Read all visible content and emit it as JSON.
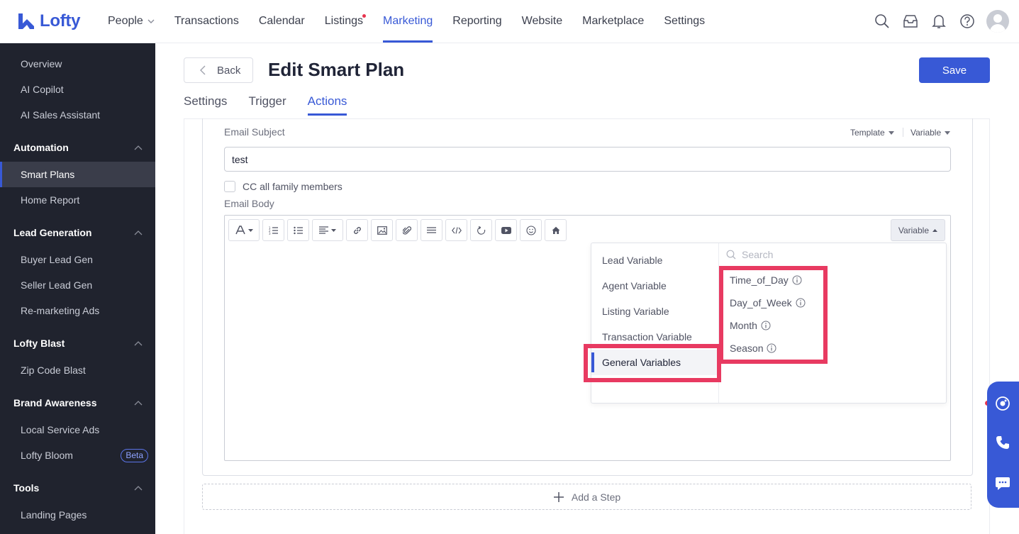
{
  "brand": {
    "name": "Lofty",
    "color": "#3859d6"
  },
  "nav": {
    "items": [
      "People",
      "Transactions",
      "Calendar",
      "Listings",
      "Marketing",
      "Reporting",
      "Website",
      "Marketplace",
      "Settings"
    ],
    "active": "Marketing"
  },
  "sidebar": {
    "top_items": [
      "Overview",
      "AI Copilot",
      "AI Sales Assistant"
    ],
    "groups": [
      {
        "title": "Automation",
        "items": [
          "Smart Plans",
          "Home Report"
        ]
      },
      {
        "title": "Lead Generation",
        "items": [
          "Buyer Lead Gen",
          "Seller Lead Gen",
          "Re-marketing Ads"
        ]
      },
      {
        "title": "Lofty Blast",
        "items": [
          "Zip Code Blast"
        ]
      },
      {
        "title": "Brand Awareness",
        "items": [
          "Local Service Ads",
          "Lofty Bloom"
        ]
      },
      {
        "title": "Tools",
        "items": [
          "Landing Pages"
        ]
      }
    ],
    "active_item": "Smart Plans",
    "beta_badge": "Beta"
  },
  "header": {
    "back_label": "Back",
    "title": "Edit Smart Plan",
    "save_label": "Save"
  },
  "tabs": [
    "Settings",
    "Trigger",
    "Actions"
  ],
  "active_tab": "Actions",
  "email": {
    "subject_label": "Email Subject",
    "template_label": "Template",
    "variable_label": "Variable",
    "subject_value": "test",
    "cc_label": "CC all family members",
    "body_label": "Email Body",
    "editor_variable_label": "Variable"
  },
  "variable_popover": {
    "categories": [
      "Lead Variable",
      "Agent Variable",
      "Listing Variable",
      "Transaction Variable",
      "General Variables"
    ],
    "active_category": "General Variables",
    "search_placeholder": "Search",
    "options": [
      "Time_of_Day",
      "Day_of_Week",
      "Month",
      "Season"
    ]
  },
  "add_step_label": "Add a Step",
  "highlight_color": "#e83a61"
}
